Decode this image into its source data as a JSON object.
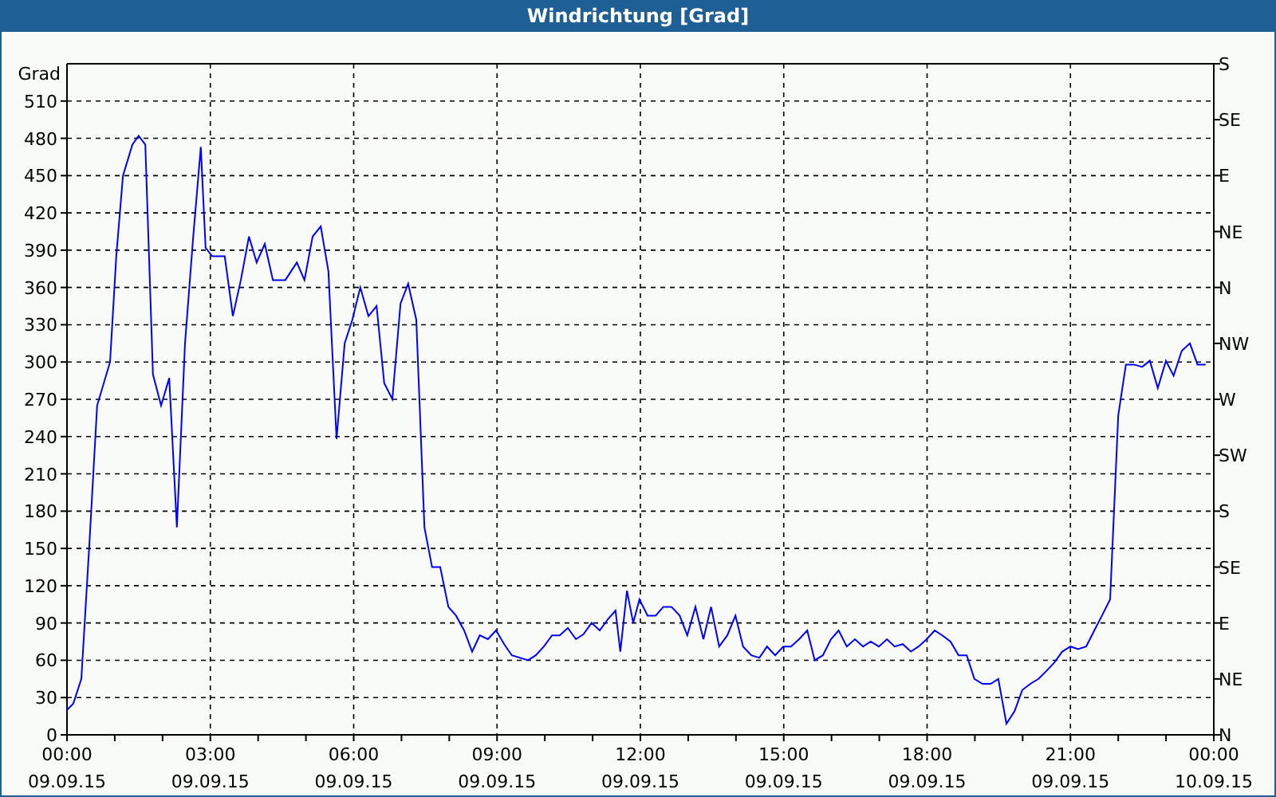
{
  "window": {
    "title": "Windrichtung [Grad]"
  },
  "chart": {
    "direction_labels": [
      "S",
      "SE",
      "E",
      "NE",
      "N",
      "NW",
      "W",
      "SW",
      "S",
      "SE",
      "E",
      "NE",
      "N"
    ],
    "x_tick_dates": [
      "09.09.15",
      "09.09.15",
      "09.09.15",
      "09.09.15",
      "09.09.15",
      "09.09.15",
      "09.09.15",
      "09.09.15",
      "10.09.15"
    ],
    "chart_data": {
      "type": "line",
      "grid": true,
      "ylabel": "Grad",
      "xlim": [
        0,
        24
      ],
      "ylim": [
        0,
        540
      ],
      "yticks": [
        0,
        30,
        60,
        90,
        120,
        150,
        180,
        210,
        240,
        270,
        300,
        330,
        360,
        390,
        420,
        450,
        480,
        510
      ],
      "xticks": [
        {
          "value": 0,
          "label": "00:00"
        },
        {
          "value": 3,
          "label": "03:00"
        },
        {
          "value": 6,
          "label": "06:00"
        },
        {
          "value": 9,
          "label": "09:00"
        },
        {
          "value": 12,
          "label": "12:00"
        },
        {
          "value": 15,
          "label": "15:00"
        },
        {
          "value": 18,
          "label": "18:00"
        },
        {
          "value": 21,
          "label": "21:00"
        },
        {
          "value": 24,
          "label": "00:00"
        }
      ],
      "x": [
        0,
        0.13,
        0.3,
        0.47,
        0.63,
        0.9,
        1.03,
        1.17,
        1.37,
        1.5,
        1.64,
        1.8,
        1.97,
        2.14,
        2.3,
        2.47,
        2.64,
        2.8,
        2.9,
        3.04,
        3.3,
        3.47,
        3.64,
        3.81,
        3.97,
        4.14,
        4.31,
        4.57,
        4.81,
        4.97,
        5.14,
        5.31,
        5.47,
        5.64,
        5.81,
        5.97,
        6.14,
        6.31,
        6.48,
        6.64,
        6.81,
        6.98,
        7.14,
        7.31,
        7.48,
        7.64,
        7.81,
        7.98,
        8.14,
        8.31,
        8.48,
        8.64,
        8.81,
        8.98,
        9.15,
        9.31,
        9.65,
        9.81,
        9.98,
        10.15,
        10.31,
        10.48,
        10.65,
        10.81,
        10.98,
        11.15,
        11.32,
        11.48,
        11.58,
        11.72,
        11.85,
        11.98,
        12.15,
        12.32,
        12.48,
        12.65,
        12.82,
        12.98,
        13.15,
        13.32,
        13.48,
        13.65,
        13.82,
        13.99,
        14.15,
        14.32,
        14.49,
        14.65,
        14.82,
        14.99,
        15.15,
        15.32,
        15.49,
        15.65,
        15.82,
        15.99,
        16.15,
        16.32,
        16.49,
        16.66,
        16.82,
        16.99,
        17.16,
        17.32,
        17.49,
        17.66,
        17.82,
        17.99,
        18.16,
        18.32,
        18.49,
        18.66,
        18.83,
        18.99,
        19.16,
        19.33,
        19.49,
        19.66,
        19.83,
        19.99,
        20.16,
        20.33,
        20.49,
        20.66,
        20.83,
        21.0,
        21.16,
        21.33,
        21.5,
        21.66,
        21.83,
        22.0,
        22.16,
        22.33,
        22.5,
        22.66,
        22.83,
        23.0,
        23.16,
        23.33,
        23.5,
        23.66,
        23.83
      ],
      "series": [
        {
          "color": "#0000ff",
          "values": [
            20,
            25,
            45,
            155,
            265,
            300,
            385,
            450,
            475,
            482,
            475,
            290,
            265,
            287,
            167,
            315,
            400,
            473,
            392,
            385,
            385,
            337,
            366,
            401,
            380,
            395,
            366,
            366,
            380,
            366,
            401,
            409,
            373,
            238,
            315,
            334,
            360,
            337,
            345,
            283,
            270,
            347,
            363,
            334,
            167,
            135,
            135,
            103,
            96,
            84,
            67,
            80,
            77,
            84,
            73,
            64,
            60,
            64,
            71,
            80,
            80,
            86,
            77,
            81,
            90,
            84,
            93,
            100,
            67,
            116,
            90,
            109,
            96,
            96,
            103,
            103,
            96,
            80,
            103,
            77,
            103,
            71,
            80,
            96,
            71,
            64,
            62,
            71,
            64,
            71,
            71,
            77,
            84,
            60,
            64,
            77,
            84,
            71,
            77,
            71,
            75,
            71,
            77,
            71,
            73,
            67,
            71,
            77,
            84,
            80,
            75,
            64,
            64,
            45,
            41,
            41,
            45,
            9,
            19,
            36,
            41,
            45,
            51,
            58,
            67,
            71,
            69,
            71,
            84,
            96,
            109,
            257,
            298,
            298,
            296,
            301,
            279,
            301,
            289,
            309,
            315,
            298,
            298
          ]
        }
      ]
    }
  }
}
